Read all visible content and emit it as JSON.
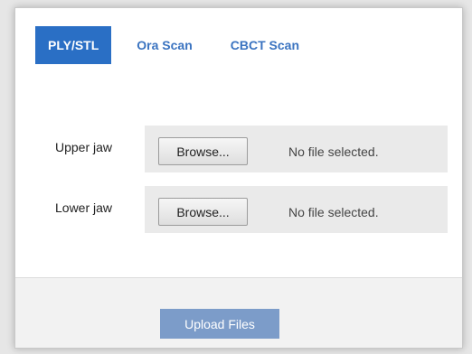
{
  "tabs": [
    {
      "label": "PLY/STL",
      "active": true
    },
    {
      "label": "Ora Scan",
      "active": false
    },
    {
      "label": "CBCT Scan",
      "active": false
    }
  ],
  "rows": [
    {
      "label": "Upper jaw",
      "button": "Browse...",
      "status": "No file selected."
    },
    {
      "label": "Lower jaw",
      "button": "Browse...",
      "status": "No file selected."
    }
  ],
  "footer": {
    "upload_label": "Upload Files"
  }
}
